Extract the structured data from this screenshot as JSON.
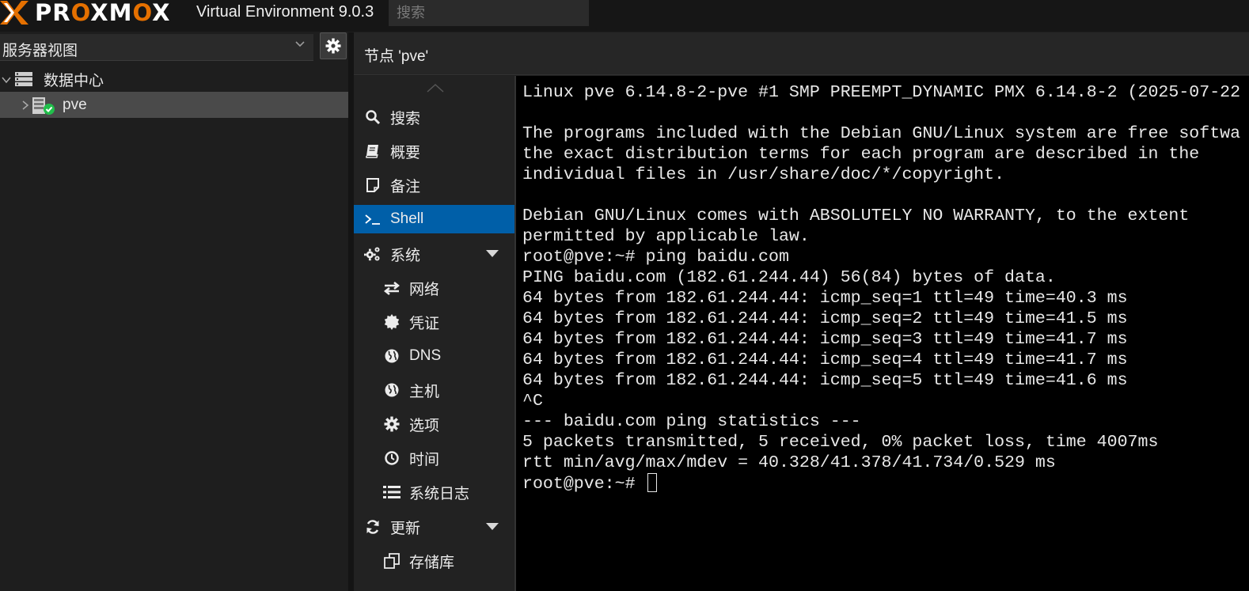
{
  "app": {
    "logo_text_a": "PR",
    "logo_text_o1": "O",
    "logo_text_b": "XM",
    "logo_text_o2": "O",
    "logo_text_c": "X",
    "version": "Virtual Environment 9.0.3",
    "search_placeholder": "搜索",
    "brand_color": "#e57000",
    "accent_color": "#005fa8"
  },
  "left_panel": {
    "view_select_value": "服务器视图",
    "tree": [
      {
        "label": "数据中心",
        "icon": "datacenter-icon",
        "expanded": true
      },
      {
        "label": "pve",
        "icon": "node-online-icon",
        "expanded": false,
        "selected": true
      }
    ]
  },
  "content": {
    "title": "节点 'pve'"
  },
  "nav": {
    "items": [
      {
        "label": "搜索",
        "icon": "search-icon"
      },
      {
        "label": "概要",
        "icon": "book-icon"
      },
      {
        "label": "备注",
        "icon": "note-icon"
      },
      {
        "label": "Shell",
        "icon": "terminal-icon",
        "active": true
      },
      {
        "label": "系统",
        "icon": "cogs-icon",
        "expandable": true
      },
      {
        "label": "网络",
        "icon": "exchange-icon",
        "sub": true
      },
      {
        "label": "凭证",
        "icon": "certificate-icon",
        "sub": true
      },
      {
        "label": "DNS",
        "icon": "globe-icon",
        "sub": true
      },
      {
        "label": "主机",
        "icon": "globe-icon",
        "sub": true
      },
      {
        "label": "选项",
        "icon": "gear-icon",
        "sub": true
      },
      {
        "label": "时间",
        "icon": "clock-icon",
        "sub": true
      },
      {
        "label": "系统日志",
        "icon": "list-icon",
        "sub": true
      },
      {
        "label": "更新",
        "icon": "refresh-icon",
        "expandable": true
      },
      {
        "label": "存储库",
        "icon": "files-icon",
        "sub": true
      }
    ]
  },
  "terminal": {
    "lines": [
      "Linux pve 6.14.8-2-pve #1 SMP PREEMPT_DYNAMIC PMX 6.14.8-2 (2025-07-22",
      "",
      "The programs included with the Debian GNU/Linux system are free softwa",
      "the exact distribution terms for each program are described in the",
      "individual files in /usr/share/doc/*/copyright.",
      "",
      "Debian GNU/Linux comes with ABSOLUTELY NO WARRANTY, to the extent",
      "permitted by applicable law.",
      "root@pve:~# ping baidu.com",
      "PING baidu.com (182.61.244.44) 56(84) bytes of data.",
      "64 bytes from 182.61.244.44: icmp_seq=1 ttl=49 time=40.3 ms",
      "64 bytes from 182.61.244.44: icmp_seq=2 ttl=49 time=41.5 ms",
      "64 bytes from 182.61.244.44: icmp_seq=3 ttl=49 time=41.7 ms",
      "64 bytes from 182.61.244.44: icmp_seq=4 ttl=49 time=41.7 ms",
      "64 bytes from 182.61.244.44: icmp_seq=5 ttl=49 time=41.6 ms",
      "^C",
      "--- baidu.com ping statistics ---",
      "5 packets transmitted, 5 received, 0% packet loss, time 4007ms",
      "rtt min/avg/max/mdev = 40.328/41.378/41.734/0.529 ms",
      "root@pve:~# "
    ]
  }
}
